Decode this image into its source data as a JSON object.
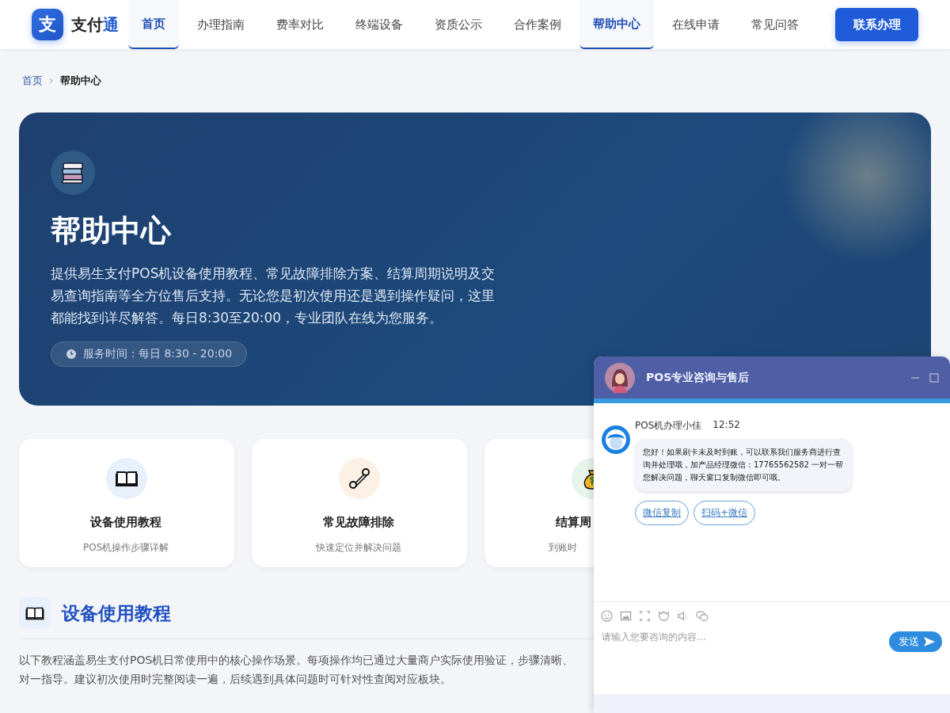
{
  "nav": {
    "logo_char": "支",
    "brand_main": "支付",
    "brand_accent": "通",
    "items": [
      {
        "label": "首页",
        "selected": true
      },
      {
        "label": "办理指南",
        "selected": false
      },
      {
        "label": "费率对比",
        "selected": false
      },
      {
        "label": "终端设备",
        "selected": false
      },
      {
        "label": "资质公示",
        "selected": false
      },
      {
        "label": "合作案例",
        "selected": false
      },
      {
        "label": "帮助中心",
        "selected": true
      },
      {
        "label": "在线申请",
        "selected": false
      },
      {
        "label": "常见问答",
        "selected": false
      }
    ],
    "cta": "联系办理"
  },
  "breadcrumb": [
    "首页",
    "帮助中心"
  ],
  "hero": {
    "title": "帮助中心",
    "description": "提供易生支付POS机设备使用教程、常见故障排除方案、结算周期说明及交易查询指南等全方位售后支持。无论您是初次使用还是遇到操作疑问，这里都能找到详尽解答。每日8:30至20:00，专业团队在线为您服务。",
    "badge": "服务时间：每日 8:30 - 20:00"
  },
  "feature_cards": [
    {
      "kind": "book",
      "title": "设备使用教程",
      "subtitle": "POS机操作步骤详解"
    },
    {
      "kind": "wrench",
      "title": "常见故障排除",
      "subtitle": "快速定位并解决问题"
    },
    {
      "kind": "moneybag",
      "title": "结算周",
      "subtitle": "到账时"
    }
  ],
  "section": {
    "title": "设备使用教程",
    "lines": [
      "以下教程涵盖易生支付POS机日常使用中的核心操作场景。每项操作均已通过大量商户实际使用验证，步骤清晰、",
      "对一指导。建议初次使用时完整阅读一遍，后续遇到具体问题时可针对性查阅对应板块。"
    ]
  },
  "chat": {
    "title": "POS专业咨询与售后",
    "agent": "POS机办理小佳",
    "time": "12:52",
    "message": "您好！如果刷卡未及时到账，可以联系我们服务商进行查询并处理哦，加产品经理微信：17765562582 一对一帮您解决问题，聊天窗口复制微信即可哦。",
    "actions": [
      "微信复制",
      "扫码+微信"
    ],
    "placeholder": "请输入您要咨询的内容...",
    "send": "发送"
  }
}
